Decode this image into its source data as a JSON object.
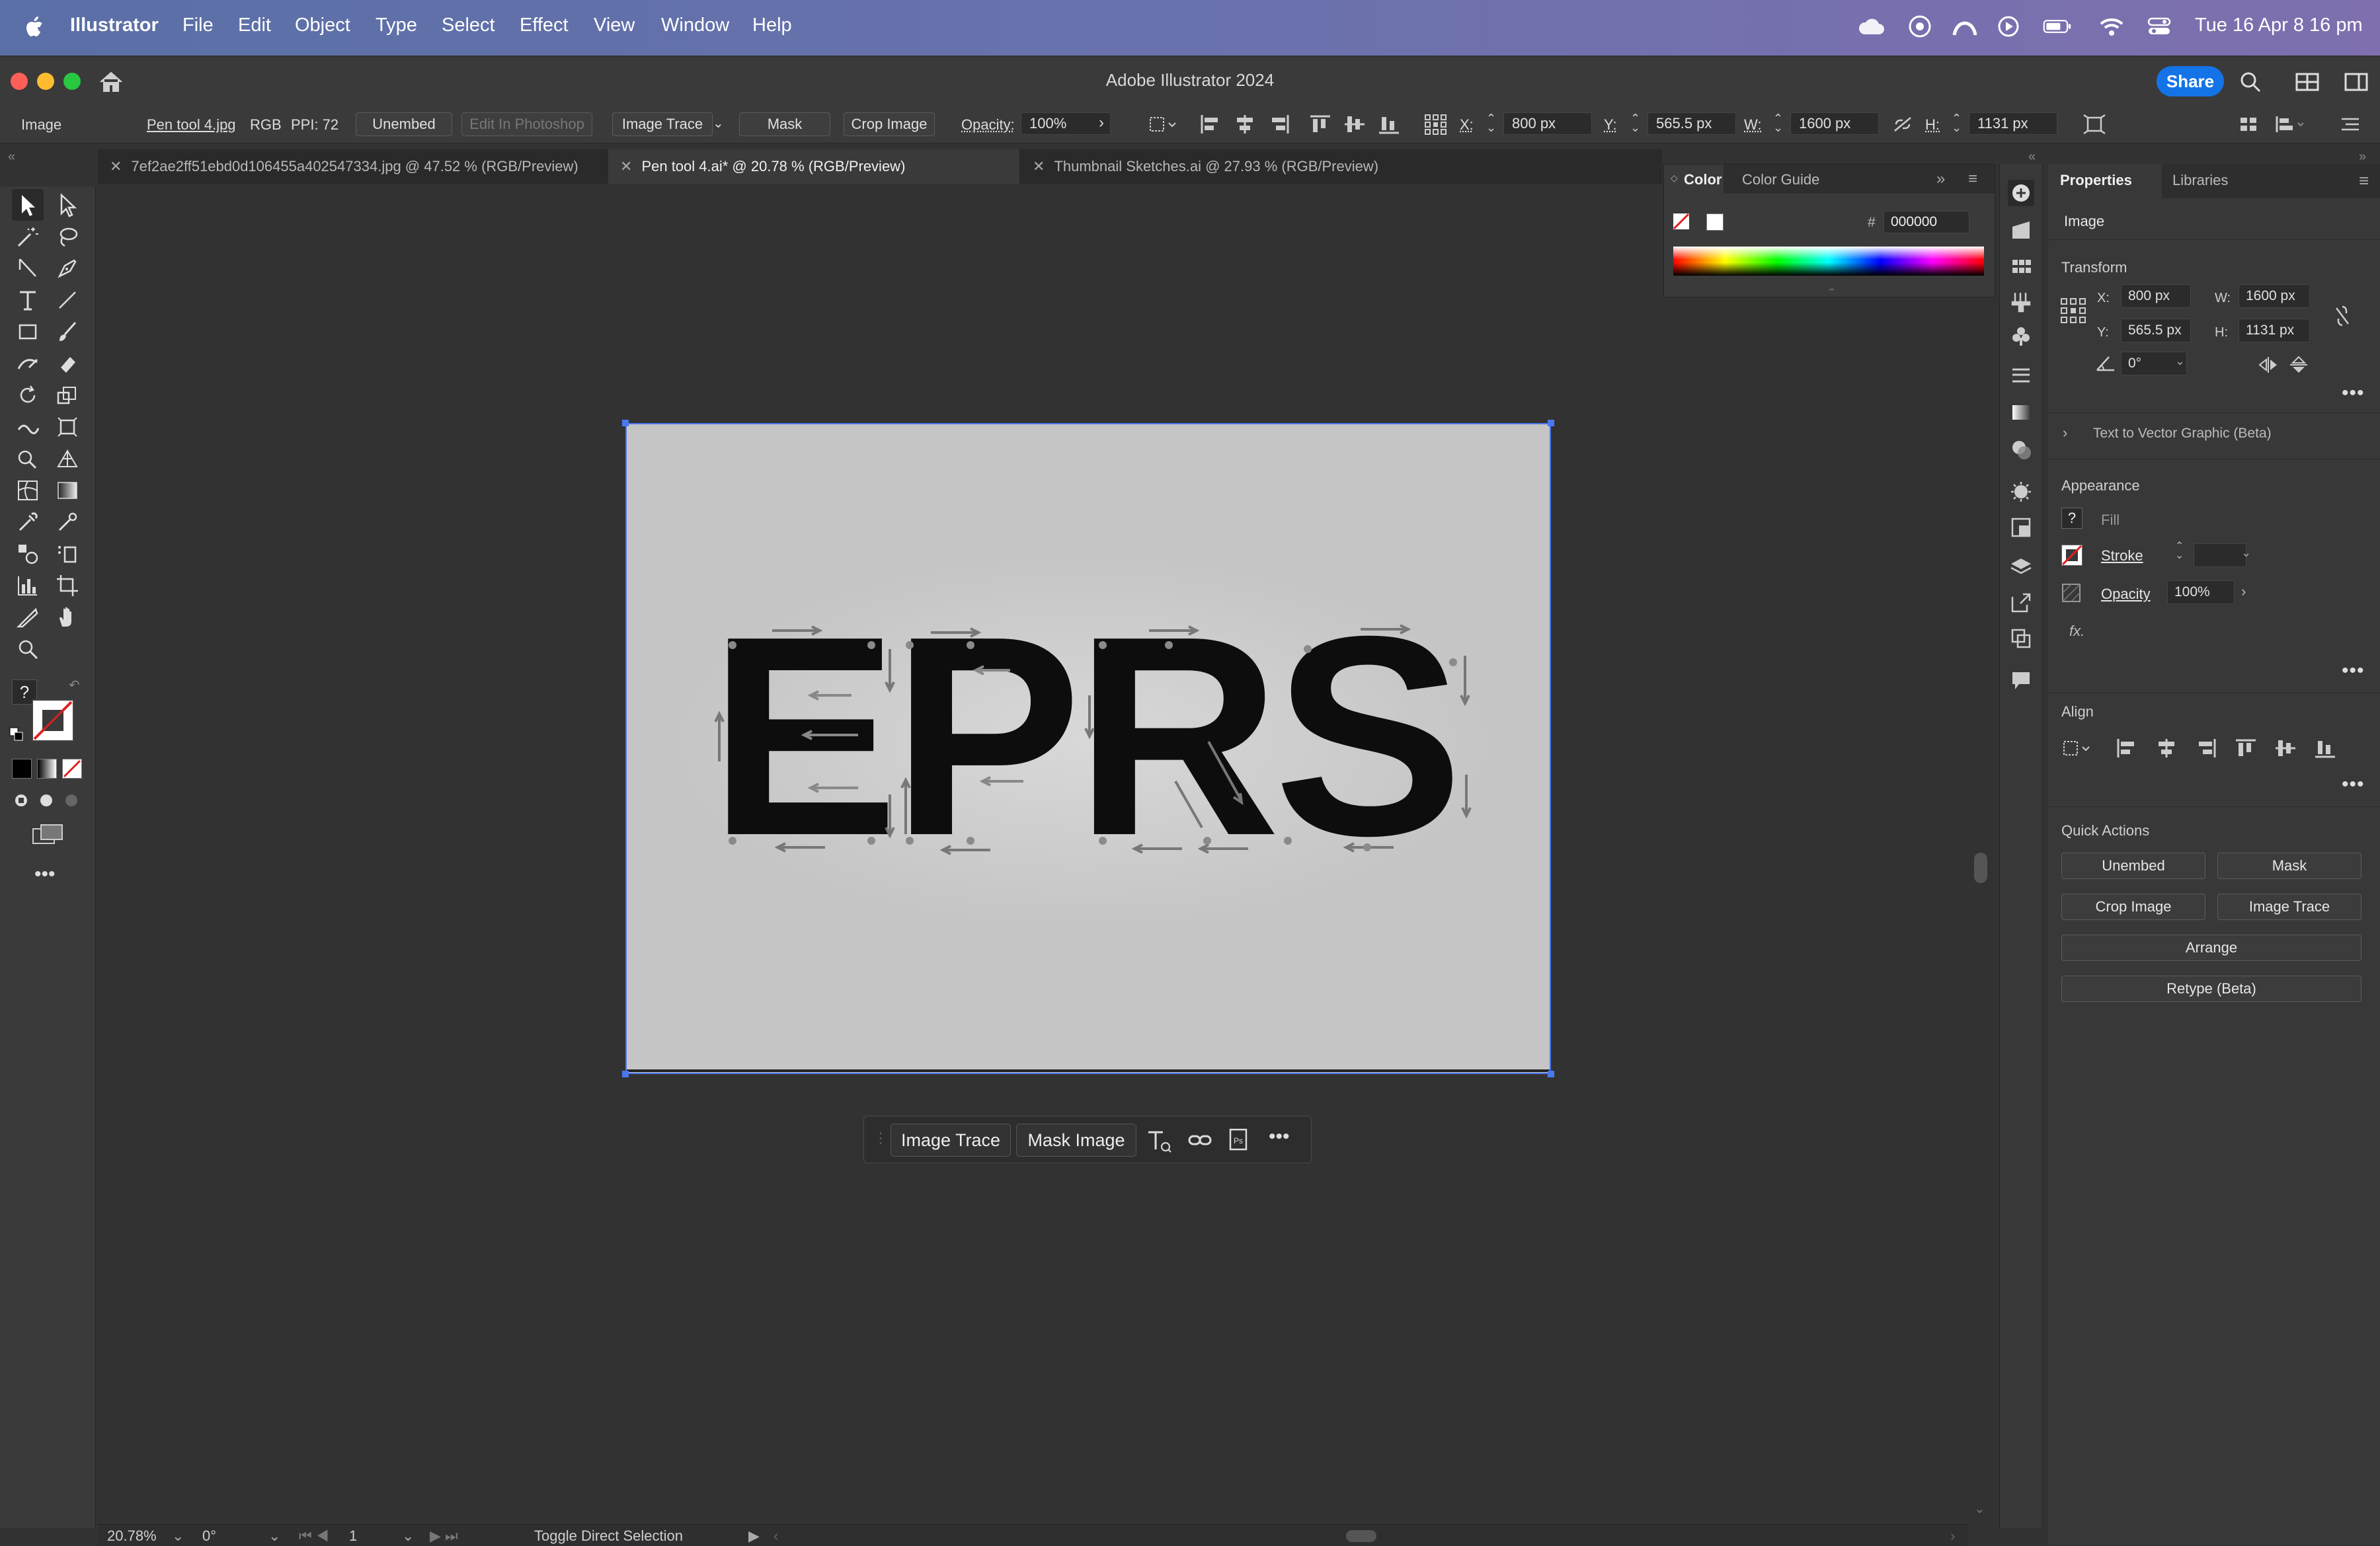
{
  "menubar": {
    "app_name": "Illustrator",
    "items": [
      "File",
      "Edit",
      "Object",
      "Type",
      "Select",
      "Effect",
      "View",
      "Window",
      "Help"
    ],
    "clock": "Tue 16 Apr  8 16 pm"
  },
  "titlebar": {
    "title": "Adobe Illustrator 2024",
    "share_label": "Share"
  },
  "control_bar": {
    "selection_type": "Image",
    "file_name": "Pen tool 4.jpg",
    "color_mode": "RGB",
    "ppi": "PPI: 72",
    "unembed_label": "Unembed",
    "edit_photoshop_label": "Edit In Photoshop",
    "image_trace_label": "Image Trace",
    "mask_label": "Mask",
    "crop_label": "Crop Image",
    "opacity_label": "Opacity:",
    "opacity_value": "100%",
    "x_label": "X:",
    "x_value": "800 px",
    "y_label": "Y:",
    "y_value": "565.5 px",
    "w_label": "W:",
    "w_value": "1600 px",
    "h_label": "H:",
    "h_value": "1131 px"
  },
  "tabs": [
    {
      "label": "7ef2ae2ff51ebd0d106455a402547334.jpg @ 47.52 % (RGB/Preview)"
    },
    {
      "label": "Pen tool 4.ai* @ 20.78 % (RGB/Preview)"
    },
    {
      "label": "Thumbnail Sketches.ai @ 27.93 % (RGB/Preview)"
    }
  ],
  "artwork": {
    "text": "EPRS"
  },
  "context_bar": {
    "image_trace_label": "Image Trace",
    "mask_image_label": "Mask Image"
  },
  "status_bar": {
    "zoom": "20.78%",
    "rotation": "0°",
    "artboard_number": "1",
    "tool_hint": "Toggle Direct Selection"
  },
  "color_panel": {
    "tab_color": "Color",
    "tab_guide": "Color Guide",
    "hash": "#",
    "hex_value": "000000"
  },
  "properties": {
    "tab_properties": "Properties",
    "tab_libraries": "Libraries",
    "selection": "Image",
    "transform_heading": "Transform",
    "x_label": "X:",
    "x_value": "800 px",
    "y_label": "Y:",
    "y_value": "565.5 px",
    "w_label": "W:",
    "w_value": "1600 px",
    "h_label": "H:",
    "h_value": "1131 px",
    "angle_value": "0°",
    "text_to_vector": "Text to Vector Graphic (Beta)",
    "appearance_heading": "Appearance",
    "fill_label": "Fill",
    "stroke_label": "Stroke",
    "opacity_label": "Opacity",
    "opacity_value": "100%",
    "fx_label": "fx.",
    "align_heading": "Align",
    "quick_actions_heading": "Quick Actions",
    "qa_unembed": "Unembed",
    "qa_mask": "Mask",
    "qa_crop": "Crop Image",
    "qa_trace": "Image Trace",
    "qa_arrange": "Arrange",
    "qa_retype": "Retype (Beta)"
  },
  "colors": {
    "selection_blue": "#4a78f0",
    "share_blue": "#1473e6",
    "artboard_gray": "#c5c5c5"
  }
}
